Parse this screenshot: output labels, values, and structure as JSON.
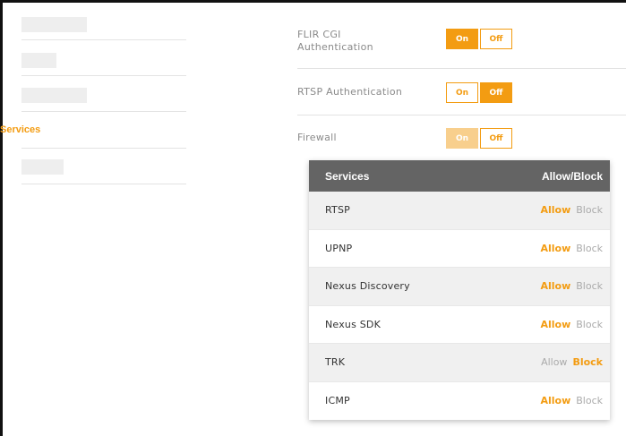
{
  "sidebar": {
    "active_label": "Services"
  },
  "settings": [
    {
      "label": "FLIR CGI\nAuthentication",
      "on": "On",
      "off": "Off",
      "state": "on"
    },
    {
      "label": "RTSP Authentication",
      "on": "On",
      "off": "Off",
      "state": "off"
    },
    {
      "label": "Firewall",
      "on": "On",
      "off": "Off",
      "state": "off-disabled-on"
    }
  ],
  "services_table": {
    "header_services": "Services",
    "header_action": "Allow/Block",
    "rows": [
      {
        "name": "RTSP",
        "allow": "Allow",
        "block": "Block",
        "selected": "allow"
      },
      {
        "name": "UPNP",
        "allow": "Allow",
        "block": "Block",
        "selected": "allow"
      },
      {
        "name": "Nexus Discovery",
        "allow": "Allow",
        "block": "Block",
        "selected": "allow"
      },
      {
        "name": "Nexus SDK",
        "allow": "Allow",
        "block": "Block",
        "selected": "allow"
      },
      {
        "name": "TRK",
        "allow": "Allow",
        "block": "Block",
        "selected": "block"
      },
      {
        "name": "ICMP",
        "allow": "Allow",
        "block": "Block",
        "selected": "allow"
      }
    ]
  },
  "colors": {
    "accent": "#f39c12",
    "accent_disabled": "#f8cf8d",
    "table_header": "#646464"
  }
}
